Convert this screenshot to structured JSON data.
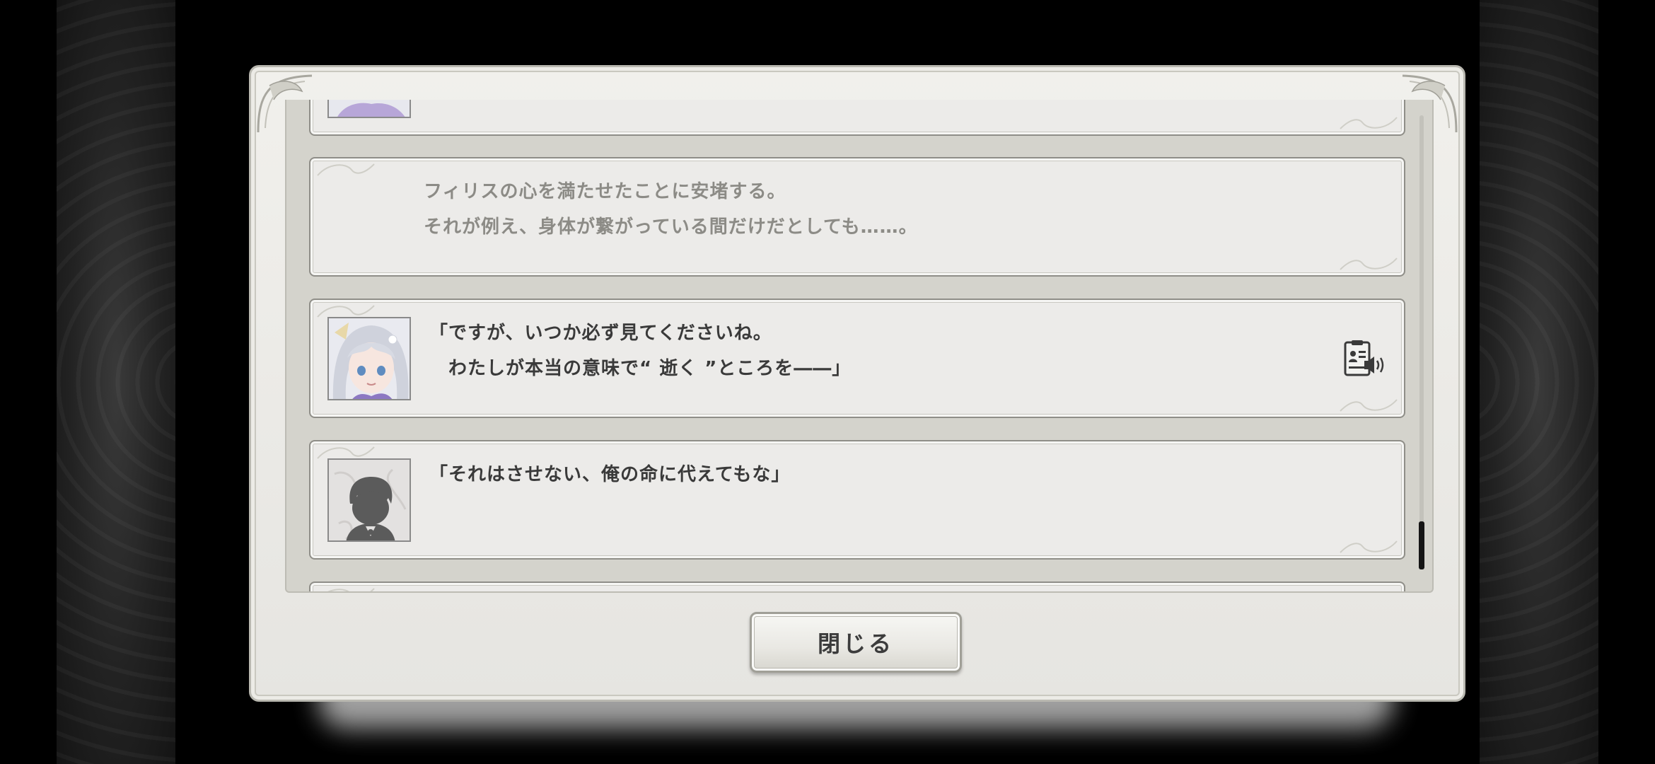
{
  "log": {
    "entries": [
      {
        "type": "dialogue",
        "speaker_icon": "heroine-portrait",
        "lines": [],
        "voice": false
      },
      {
        "type": "narration",
        "lines": [
          "フィリスの心を満たせたことに安堵する。",
          "それが例え、身体が繋がっている間だけだとしても……。"
        ]
      },
      {
        "type": "dialogue",
        "speaker_icon": "heroine-portrait",
        "lines": [
          "「ですが、いつか必ず見てくださいね。",
          "　わたしが本当の意味で“ 逝く ”ところを――」"
        ],
        "voice": true
      },
      {
        "type": "dialogue",
        "speaker_icon": "player-silhouette",
        "lines": [
          "「それはさせない、俺の命に代えてもな」"
        ],
        "voice": false
      }
    ]
  },
  "close_button": {
    "label": "閉じる"
  },
  "icons": {
    "voice": "voice-replay-icon"
  },
  "colors": {
    "narration_text": "#8c8b86",
    "dialogue_text": "#3a3a3a",
    "panel": "#ecebe9"
  }
}
